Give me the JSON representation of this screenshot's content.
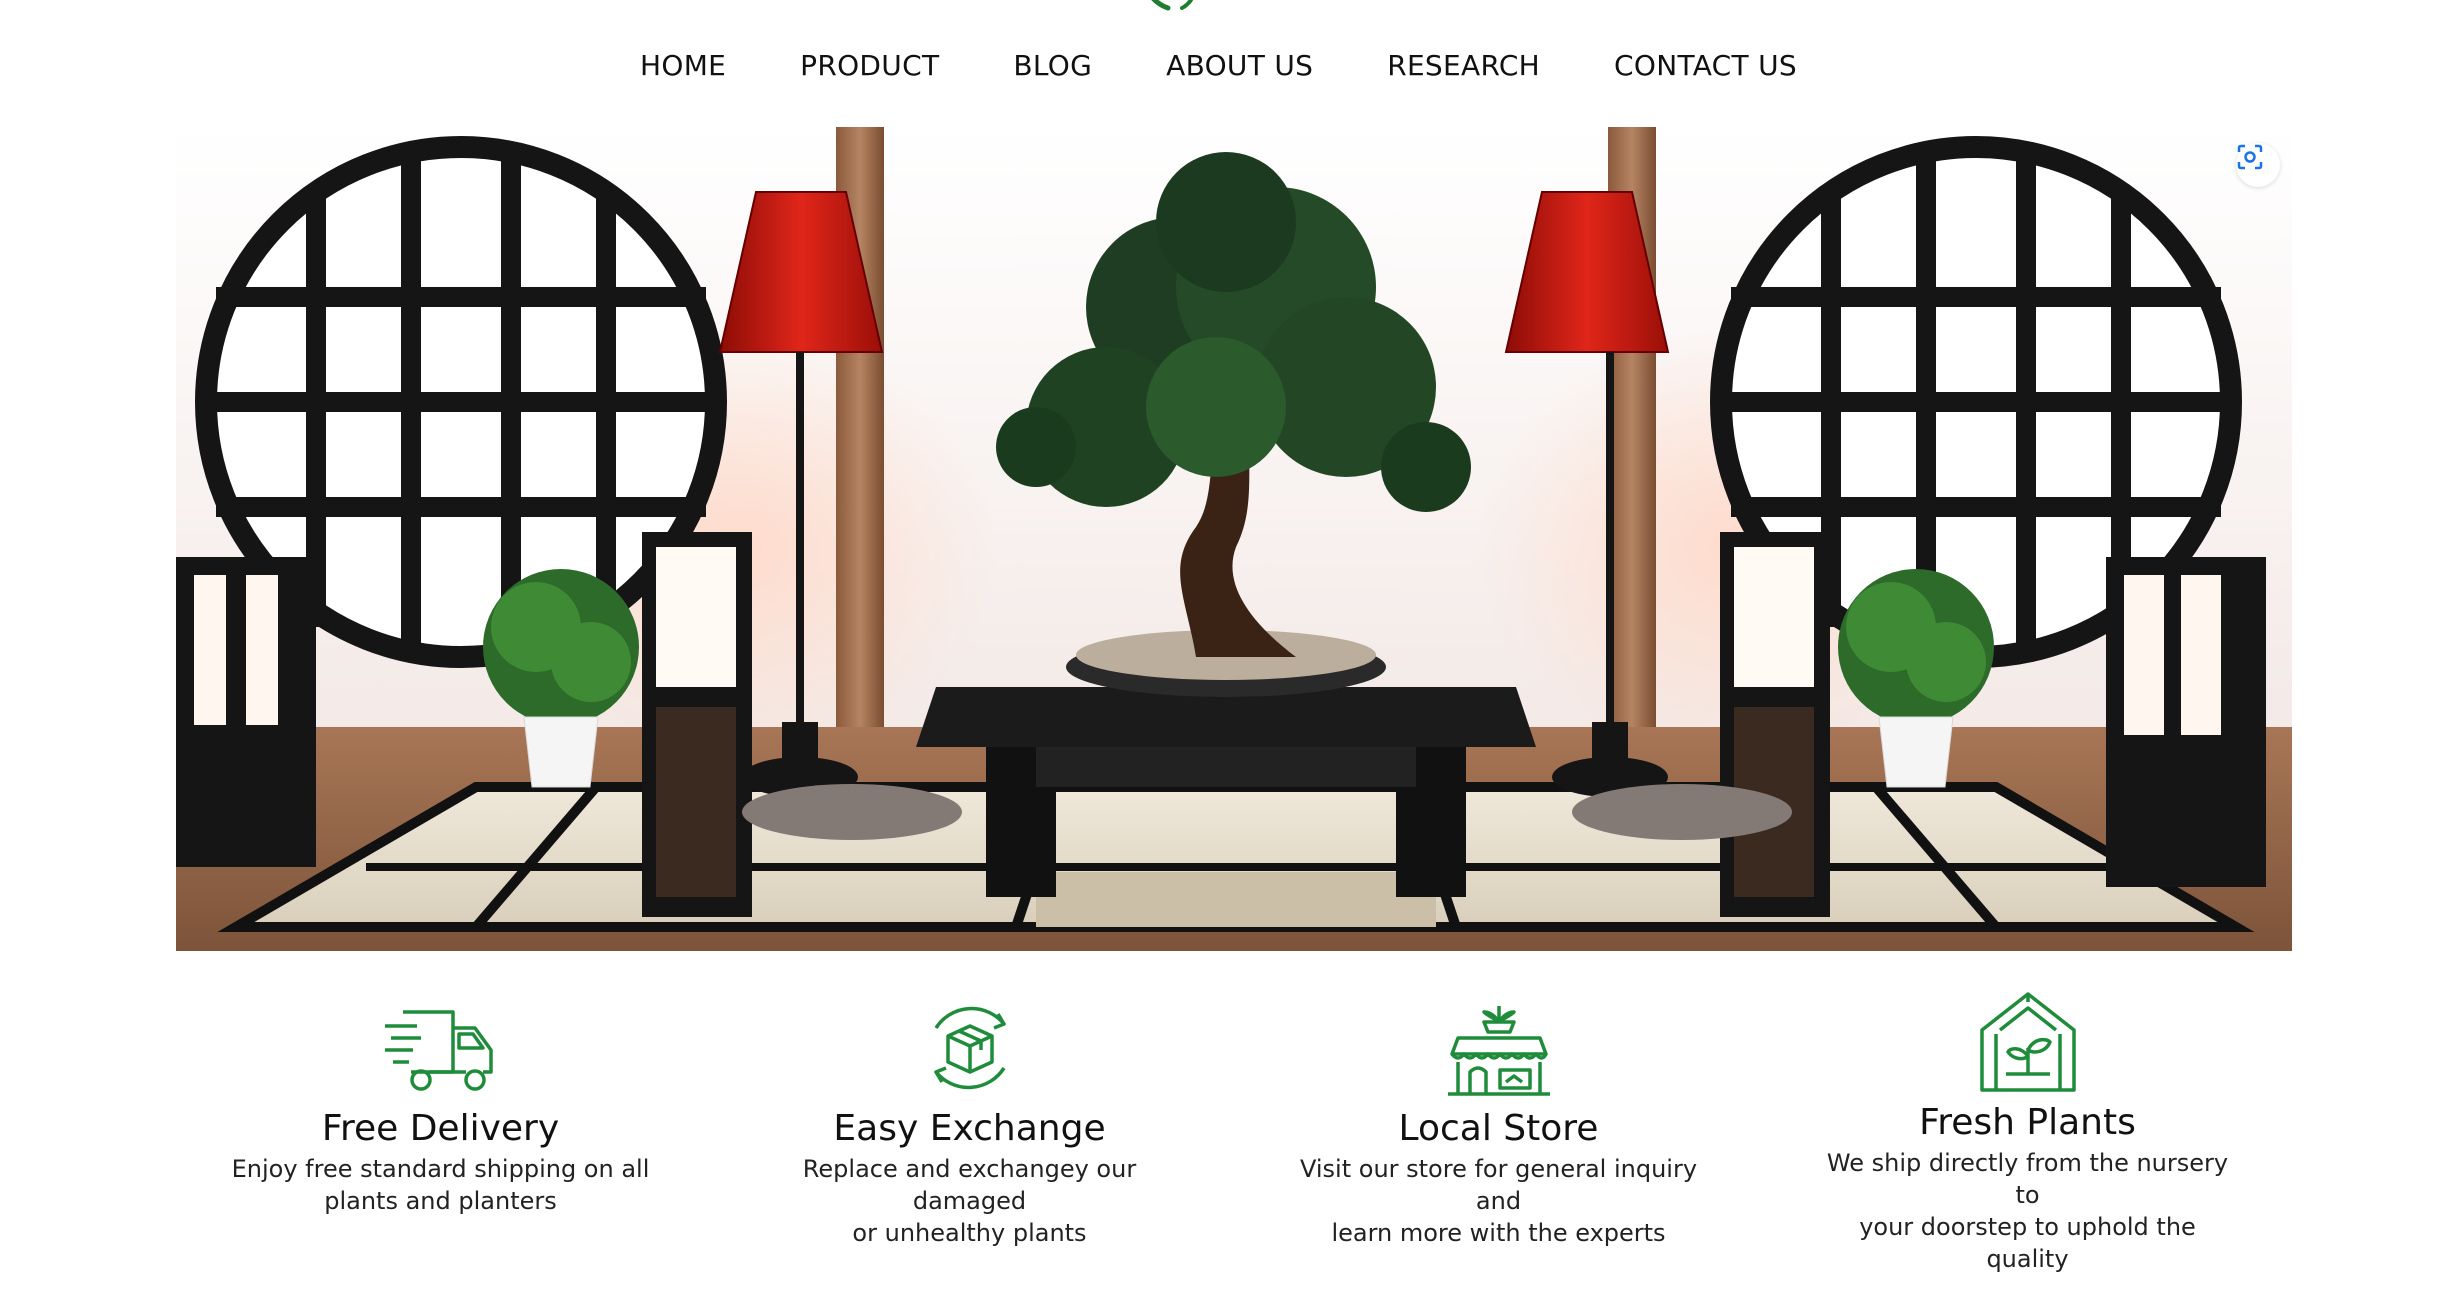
{
  "nav": {
    "items": [
      {
        "label": "HOME"
      },
      {
        "label": "PRODUCT"
      },
      {
        "label": "BLOG"
      },
      {
        "label": "ABOUT US"
      },
      {
        "label": "RESEARCH"
      },
      {
        "label": "CONTACT US"
      }
    ]
  },
  "hero": {
    "lens_icon": "visual-search-icon"
  },
  "features": [
    {
      "icon": "delivery-truck-icon",
      "title": "Free Delivery",
      "line1": "Enjoy free standard shipping on all",
      "line2": "plants and planters"
    },
    {
      "icon": "exchange-box-icon",
      "title": "Easy Exchange",
      "line1": "Replace and exchangey our damaged",
      "line2": "or unhealthy plants"
    },
    {
      "icon": "store-icon",
      "title": "Local Store",
      "line1": "Visit our store for general inquiry and",
      "line2": "learn more with the experts"
    },
    {
      "icon": "greenhouse-plant-icon",
      "title": "Fresh Plants",
      "line1": "We ship directly from the nursery to",
      "line2": "your doorstep to uphold the quality"
    }
  ],
  "colors": {
    "accent_green": "#1e8c3a",
    "lamp_red": "#d01a12",
    "frame_black": "#151515"
  }
}
